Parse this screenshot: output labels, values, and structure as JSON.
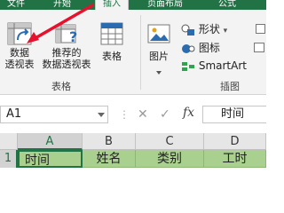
{
  "tabs": [
    "文件",
    "开始",
    "插入",
    "页面布局",
    "公式"
  ],
  "ribbon": {
    "buttons": {
      "pivot_table": [
        "数据",
        "透视表"
      ],
      "recommended_pivot": [
        "推荐的",
        "数据透视表"
      ],
      "table": "表格",
      "pictures": "图片"
    },
    "illustrations_items": [
      "形状",
      "图标",
      "SmartArt"
    ],
    "groups": {
      "tables": "表格",
      "illustrations": "插图"
    }
  },
  "formula_bar": {
    "name_box": "A1",
    "cancel": "✕",
    "enter": "✓",
    "fx": "fx",
    "content": "时间"
  },
  "grid": {
    "columns": [
      "A",
      "B",
      "C",
      "D"
    ],
    "rows": [
      "1"
    ],
    "cells": [
      "时间",
      "姓名",
      "类别",
      "工时"
    ]
  },
  "colors": {
    "accent": "#217346",
    "header_fill": "#a9d08e",
    "annotation_arrow": "#e8112d"
  }
}
